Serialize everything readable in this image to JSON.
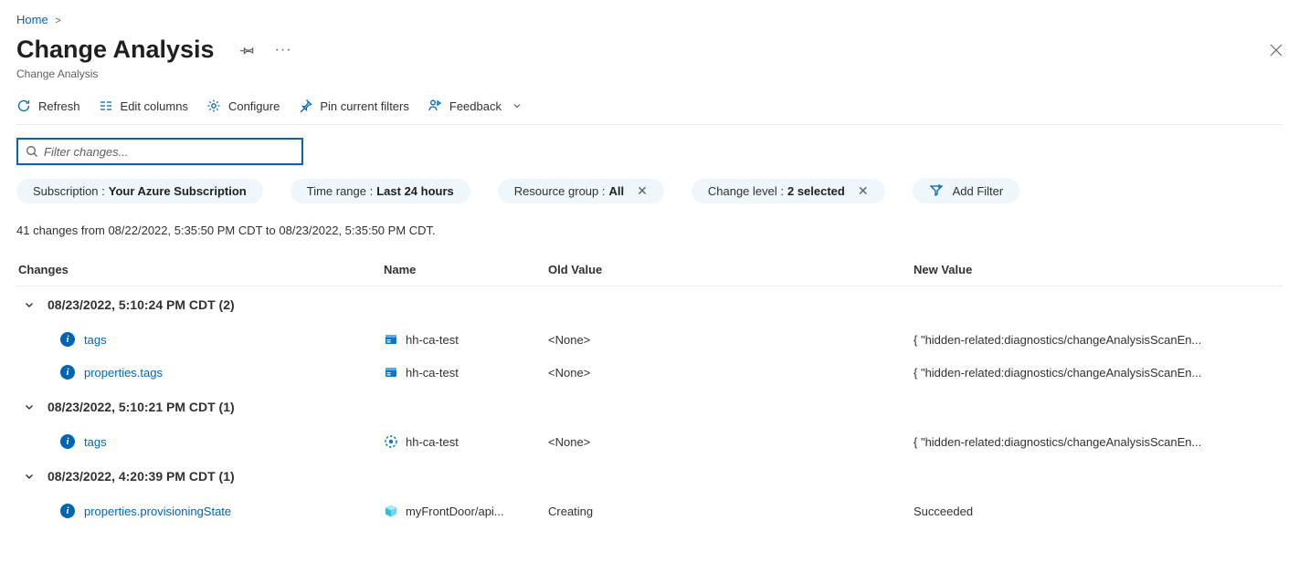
{
  "breadcrumb": {
    "home": "Home"
  },
  "page_title": "Change Analysis",
  "page_subtitle": "Change Analysis",
  "toolbar": {
    "refresh": "Refresh",
    "edit_columns": "Edit columns",
    "configure": "Configure",
    "pin_filters": "Pin current filters",
    "feedback": "Feedback"
  },
  "filter": {
    "placeholder": "Filter changes..."
  },
  "pills": {
    "subscription_label": "Subscription : ",
    "subscription_value": "Your Azure Subscription",
    "timerange_label": "Time range : ",
    "timerange_value": "Last 24 hours",
    "rgroup_label": "Resource group : ",
    "rgroup_value": "All",
    "changelevel_label": "Change level : ",
    "changelevel_value": "2 selected",
    "add_filter": "Add Filter"
  },
  "summary": "41 changes from 08/22/2022, 5:35:50 PM CDT to 08/23/2022, 5:35:50 PM CDT.",
  "columns": {
    "changes": "Changes",
    "name": "Name",
    "old": "Old Value",
    "new": "New Value"
  },
  "groups": [
    {
      "header": "08/23/2022, 5:10:24 PM CDT (2)",
      "rows": [
        {
          "change": "tags",
          "name": "hh-ca-test",
          "icon": "storage",
          "old": "<None>",
          "new": "{ \"hidden-related:diagnostics/changeAnalysisScanEn..."
        },
        {
          "change": "properties.tags",
          "name": "hh-ca-test",
          "icon": "storage",
          "old": "<None>",
          "new": "{ \"hidden-related:diagnostics/changeAnalysisScanEn..."
        }
      ]
    },
    {
      "header": "08/23/2022, 5:10:21 PM CDT (1)",
      "rows": [
        {
          "change": "tags",
          "name": "hh-ca-test",
          "icon": "globe",
          "old": "<None>",
          "new": "{ \"hidden-related:diagnostics/changeAnalysisScanEn..."
        }
      ]
    },
    {
      "header": "08/23/2022, 4:20:39 PM CDT (1)",
      "rows": [
        {
          "change": "properties.provisioningState",
          "name": "myFrontDoor/api...",
          "icon": "cube",
          "old": "Creating",
          "new": "Succeeded"
        }
      ]
    }
  ]
}
